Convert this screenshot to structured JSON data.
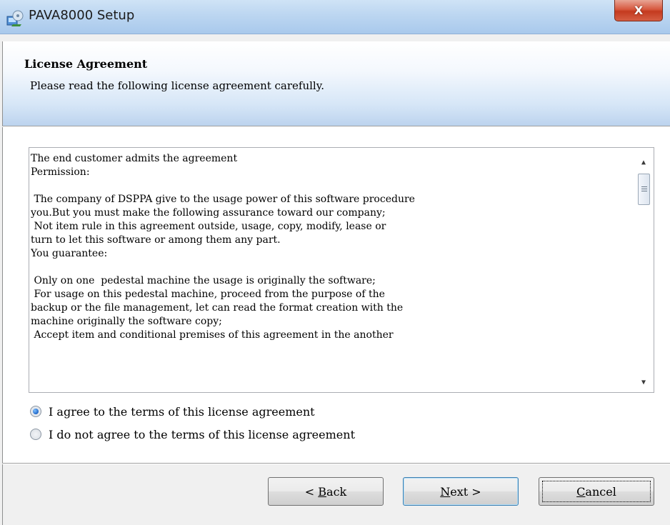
{
  "window": {
    "title": "PAVA8000 Setup",
    "close_glyph": "X",
    "icon": "installer-icon"
  },
  "header": {
    "title": "License Agreement",
    "subtitle": "Please read the following license agreement carefully."
  },
  "license": {
    "text": "The end customer admits the agreement\nPermission:\n\n The company of DSPPA give to the usage power of this software procedure\nyou.But you must make the following assurance toward our company;\n Not item rule in this agreement outside, usage, copy, modify, lease or\nturn to let this software or among them any part.\nYou guarantee:\n\n Only on one  pedestal machine the usage is originally the software;\n For usage on this pedestal machine, proceed from the purpose of the\nbackup or the file management, let can read the format creation with the\nmachine originally the software copy;\n Accept item and conditional premises of this agreement in the another",
    "scroll_up_glyph": "▲",
    "scroll_down_glyph": "▼"
  },
  "options": {
    "agree": {
      "label": "I agree to the terms of this license agreement",
      "checked": true
    },
    "disagree": {
      "label": "I do not agree to the terms of this license agreement",
      "checked": false
    }
  },
  "buttons": {
    "back": {
      "prefix": "< ",
      "mnemonic": "B",
      "rest": "ack"
    },
    "next": {
      "mnemonic": "N",
      "rest": "ext >"
    },
    "cancel": {
      "mnemonic": "C",
      "rest": "ancel"
    }
  },
  "colors": {
    "title_bar": "#bcd6f1",
    "close_button": "#c43a1f",
    "radio_selected": "#1e66c8",
    "default_button_border": "#3c7fb1"
  }
}
